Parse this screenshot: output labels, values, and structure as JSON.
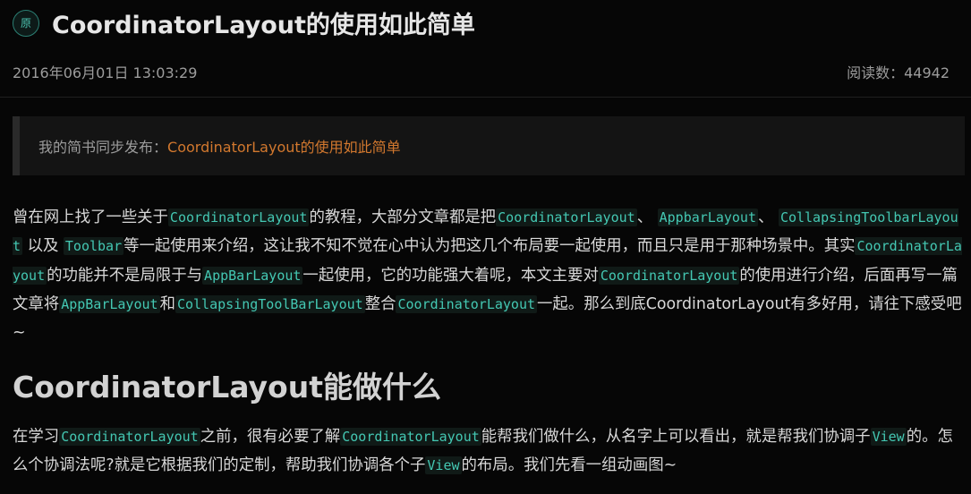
{
  "article": {
    "badge": "原",
    "title": "CoordinatorLayout的使用如此简单",
    "date": "2016年06月01日 13:03:29",
    "reads_label": "阅读数：",
    "reads_count": "44942"
  },
  "quote": {
    "prefix": "我的简书同步发布：",
    "link_text": "CoordinatorLayout的使用如此简单"
  },
  "para1": {
    "t1": "曾在网上找了一些关于",
    "c1": "CoordinatorLayout",
    "t2": "的教程，大部分文章都是把",
    "c2": "CoordinatorLayout",
    "t3": "、",
    "c3": "AppbarLayout",
    "t4": "、",
    "c4": "CollapsingToolbarLayout",
    "t5": "以及",
    "c5": "Toolbar",
    "t6": "等一起使用来介绍，这让我不知不觉在心中认为把这几个布局要一起使用，而且只是用于那种场景中。其实",
    "c6": "CoordinatorLayout",
    "t7": "的功能并不是局限于与",
    "c7": "AppBarLayout",
    "t8": "一起使用，它的功能强大着呢，本文主要对",
    "c8": "CoordinatorLayout",
    "t9": "的使用进行介绍，后面再写一篇文章将",
    "c9": "AppBarLayout",
    "t10": "和",
    "c10": "CollapsingToolBarLayout",
    "t11": "整合",
    "c11": "CoordinatorLayout",
    "t12": "一起。那么到底CoordinatorLayout有多好用，请往下感受吧~"
  },
  "heading": "CoordinatorLayout能做什么",
  "para2": {
    "t1": "在学习",
    "c1": "CoordinatorLayout",
    "t2": "之前，很有必要了解",
    "c2": "CoordinatorLayout",
    "t3": "能帮我们做什么，从名字上可以看出，就是帮我们协调子",
    "c3": "View",
    "t4": "的。怎么个协调法呢?就是它根据我们的定制，帮助我们协调各个子",
    "c4": "View",
    "t5": "的布局。我们先看一组动画图~"
  }
}
